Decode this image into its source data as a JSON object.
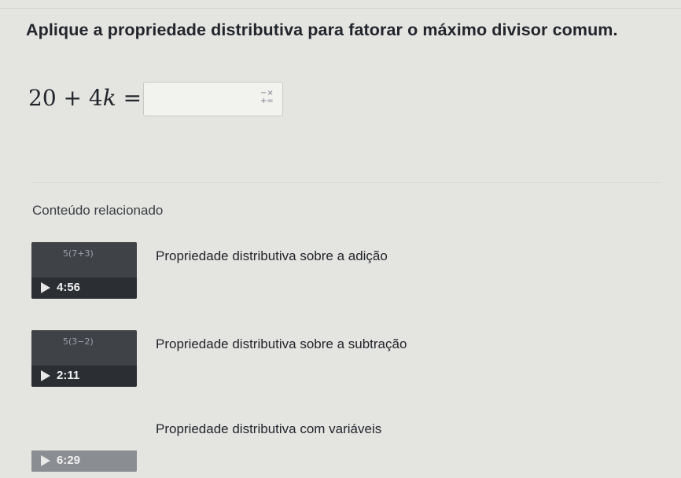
{
  "question": {
    "prompt": "Aplique a propriedade distributiva para fatorar o máximo divisor comum.",
    "equation_lhs": "20 + 4",
    "equation_var": "k",
    "equation_eq": " =",
    "answer_value": "",
    "keyboard_icon": "math-keyboard-icon"
  },
  "related": {
    "heading": "Conteúdo relacionado",
    "videos": [
      {
        "title": "Propriedade distributiva sobre a adição",
        "duration": "4:56",
        "scribble": "5(7+3)"
      },
      {
        "title": "Propriedade distributiva sobre a subtração",
        "duration": "2:11",
        "scribble": "5(3−2)"
      },
      {
        "title": "Propriedade distributiva com variáveis",
        "duration": "6:29",
        "scribble": ""
      }
    ]
  }
}
